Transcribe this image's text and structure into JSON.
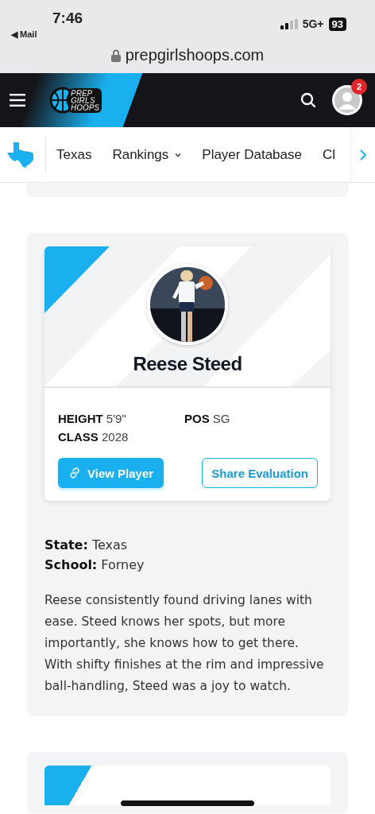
{
  "status_bar": {
    "time": "7:46",
    "back": "◀ Mail",
    "network": "5G+",
    "battery": "93"
  },
  "address_bar": {
    "url": "prepgirlshoops.com"
  },
  "header": {
    "logo": [
      "PREP",
      "GIRLS",
      "HOOPS"
    ],
    "notification_count": "2"
  },
  "nav": {
    "items": [
      {
        "label": "Texas",
        "dropdown": false
      },
      {
        "label": "Rankings",
        "dropdown": true
      },
      {
        "label": "Player Database",
        "dropdown": false
      },
      {
        "label": "Cl",
        "dropdown": false
      }
    ]
  },
  "evaluation": {
    "player": {
      "name": "Reese Steed"
    },
    "stats": [
      "**HEIGHT** 5'9\"",
      "**POS** SG",
      "**CLASS** 2028"
    ],
    "buttons": [
      {
        "label": "View Player",
        "kind": "primary"
      },
      {
        "label": "Share Evaluation",
        "kind": "outline"
      }
    ],
    "details": [
      "**State:** Texas",
      "**School:** Forney"
    ],
    "text": "Reese consistently found driving lanes with ease. Steed knows her spots, but more importantly, she knows how to get there. With shifty finishes at the rim and impressive ball-handling, Steed was a joy to watch."
  }
}
